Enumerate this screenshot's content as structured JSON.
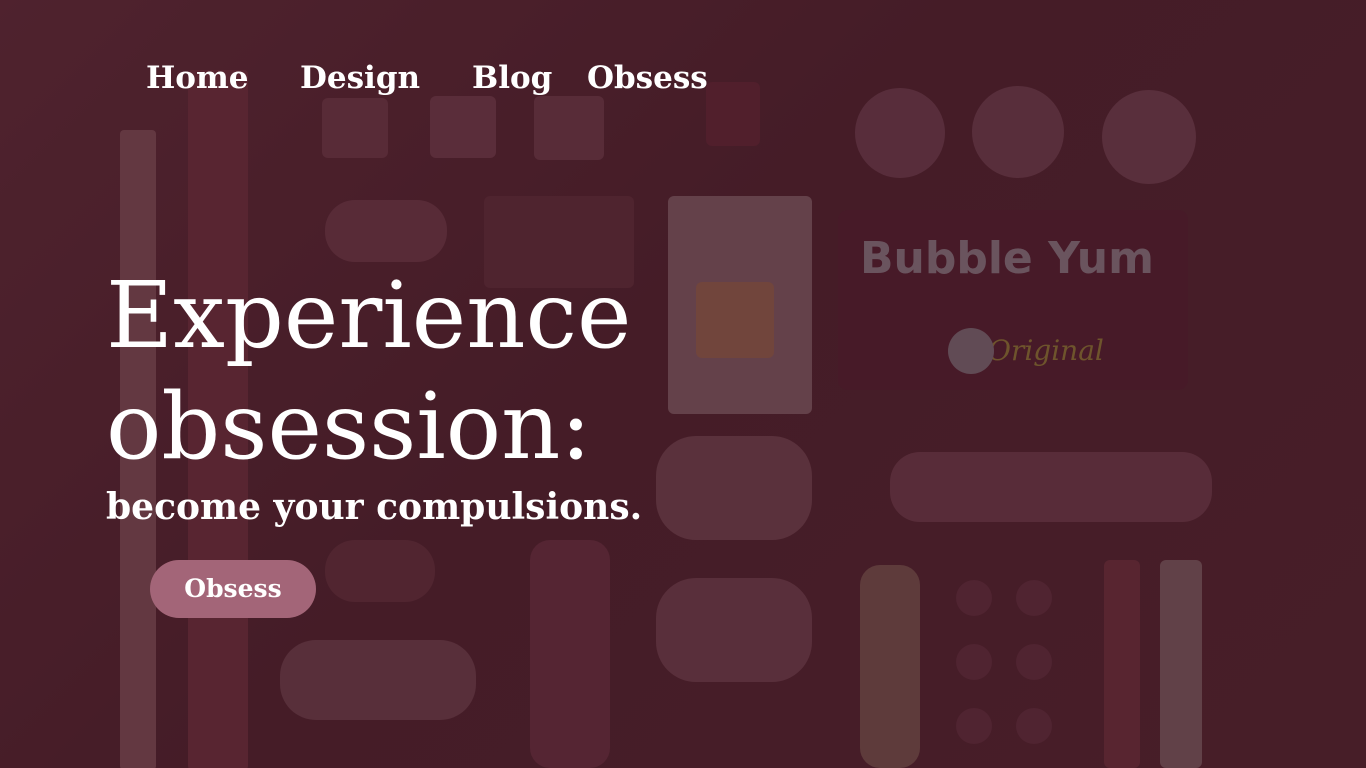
{
  "nav": {
    "items": [
      {
        "label": "Home"
      },
      {
        "label": "Design"
      },
      {
        "label": "Blog"
      },
      {
        "label": "Obsess"
      }
    ]
  },
  "hero": {
    "line1": "Experience",
    "line2": "obsession:",
    "subtitle": "become your compulsions.",
    "cta_label": "Obsess"
  },
  "background": {
    "gum_wrapper_brand": "Bubble Yum",
    "gum_wrapper_flavor": "Original"
  },
  "colors": {
    "cta_background": "#a36578",
    "text": "#ffffff",
    "overlay_tint": "#5a2a36"
  }
}
